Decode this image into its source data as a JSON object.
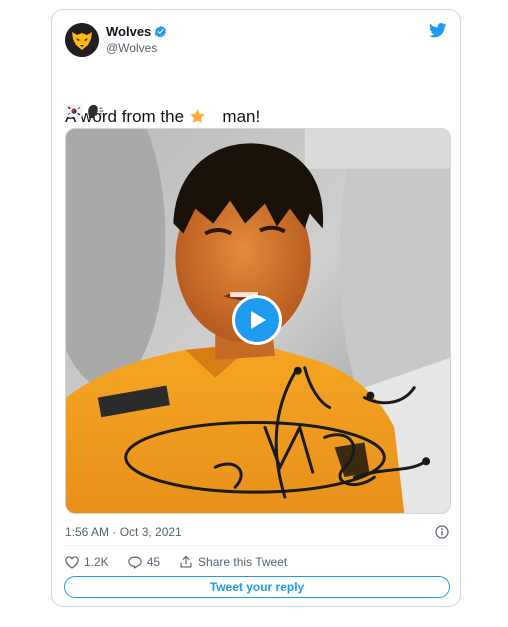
{
  "author": {
    "display_name": "Wolves",
    "handle": "@Wolves",
    "avatar_icon": "wolf-head-logo",
    "verified_icon": "verified-badge-icon"
  },
  "tweet": {
    "text_before": "A word from the",
    "emoji": "star",
    "text_after": "man!",
    "emoji_line": [
      "south-korea-flag",
      "speaking-head"
    ]
  },
  "media": {
    "type": "video",
    "play_icon": "play-icon"
  },
  "meta": {
    "timestamp": "1:56 AM · Oct 3, 2021",
    "info_icon": "info-icon"
  },
  "actions": {
    "like_count": "1.2K",
    "reply_count": "45",
    "share_label": "Share this Tweet"
  },
  "reply": {
    "button_label": "Tweet your reply"
  },
  "colors": {
    "accent": "#1d9bf0",
    "text_primary": "#0f1419",
    "text_secondary": "#536471",
    "border": "#cfd9de",
    "wolves_gold": "#fdb913",
    "wolves_black": "#231f20"
  }
}
